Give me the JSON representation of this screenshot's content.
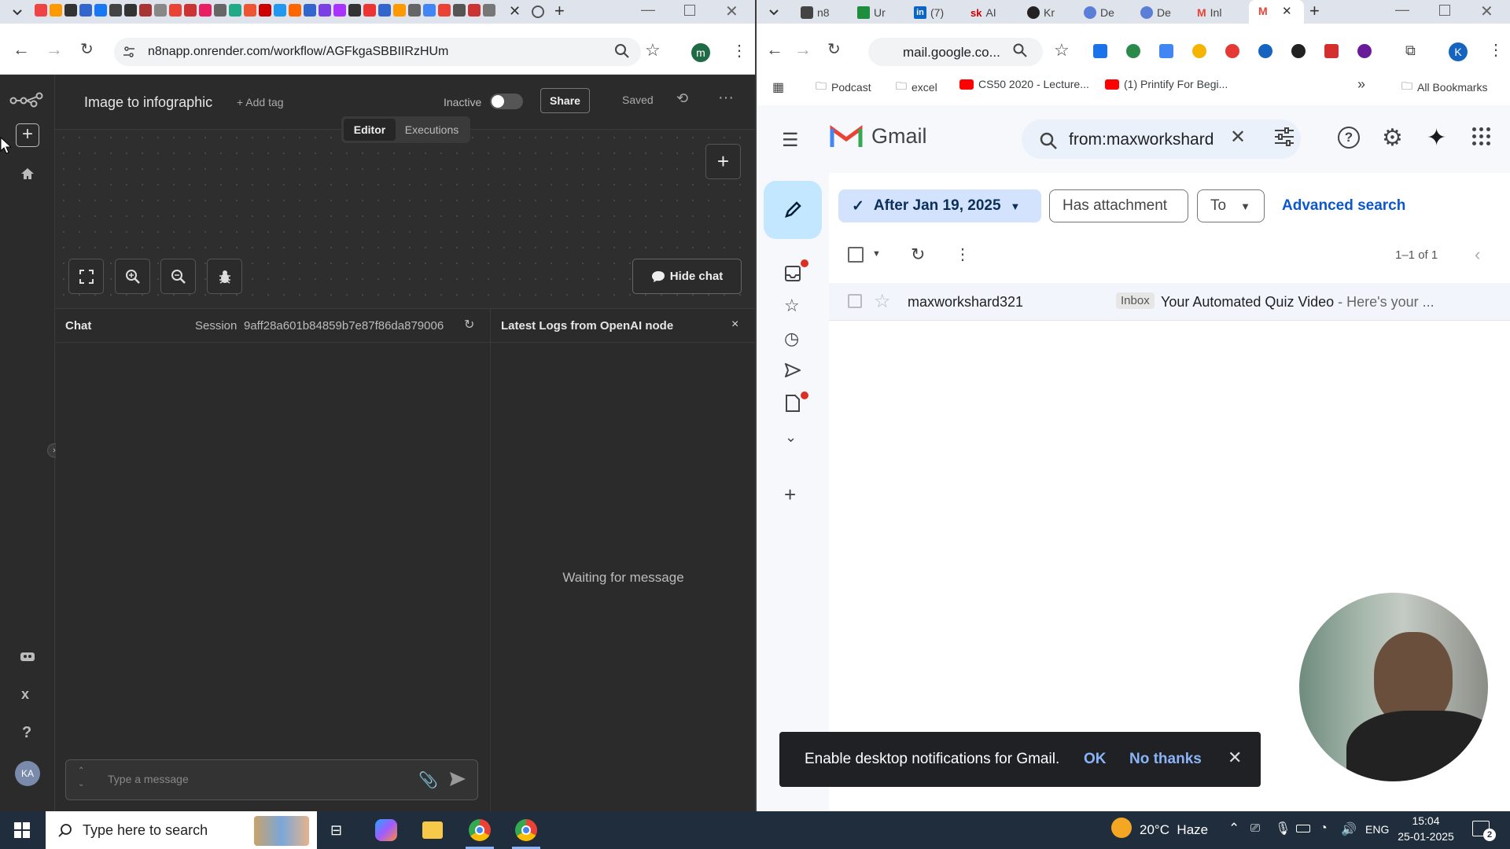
{
  "left_browser": {
    "url": "n8napp.onrender.com/workflow/AGFkgaSBBIIRzHUm",
    "profile_initial": "m"
  },
  "n8n": {
    "workflow_title": "Image to infographic",
    "add_tag": "+ Add tag",
    "status_label": "Inactive",
    "share_label": "Share",
    "saved_label": "Saved",
    "tabs": [
      "Editor",
      "Executions"
    ],
    "hide_chat_label": "Hide chat",
    "chat_title": "Chat",
    "session_label": "Session",
    "session_id": "9aff28a601b84859b7e87f86da879006",
    "logs_title": "Latest Logs from OpenAI node",
    "waiting_text": "Waiting for message",
    "message_placeholder": "Type a message",
    "user_avatar": "KA",
    "icons": [
      "logo-icon",
      "plus-icon",
      "home-icon",
      "templates-icon",
      "variables-icon",
      "help-icon"
    ]
  },
  "right_browser": {
    "tabs": [
      {
        "label": "n8",
        "icon": "n8n-icon"
      },
      {
        "label": "Ur",
        "icon": "sheets-icon"
      },
      {
        "label": "(7)",
        "icon": "linkedin-icon"
      },
      {
        "label": "AI",
        "icon": "sk-icon"
      },
      {
        "label": "Kr",
        "icon": "up-icon"
      },
      {
        "label": "De",
        "icon": "d-icon"
      },
      {
        "label": "De",
        "icon": "d-icon"
      },
      {
        "label": "Inl",
        "icon": "gmail-icon"
      }
    ],
    "url": "mail.google.co...",
    "bookmarks": [
      "Podcast",
      "excel",
      "CS50 2020 - Lecture...",
      "(1) Printify For Begi..."
    ],
    "all_bookmarks": "All Bookmarks",
    "profile_initial": "K"
  },
  "gmail": {
    "brand": "Gmail",
    "search_query": "from:maxworkshard",
    "filter_date": "After Jan 19, 2025",
    "filter_attachment": "Has attachment",
    "filter_to": "To",
    "advanced_search": "Advanced search",
    "pagination": "1–1 of 1",
    "email": {
      "sender": "maxworkshard321",
      "label": "Inbox",
      "subject": "Your Automated Quiz Video",
      "snippet": " - Here's your ..."
    },
    "notification": {
      "text": "Enable desktop notifications for Gmail.",
      "ok": "OK",
      "no_thanks": "No thanks"
    }
  },
  "taskbar": {
    "search_placeholder": "Type here to search",
    "weather": "20°C  Haze",
    "language": "ENG",
    "time": "15:04",
    "date": "25-01-2025",
    "notif_count": "2"
  },
  "colors": {
    "n8n_bg": "#2b2b2b",
    "gmail_blue": "#0b57d0",
    "taskbar": "#1f2d3d"
  }
}
